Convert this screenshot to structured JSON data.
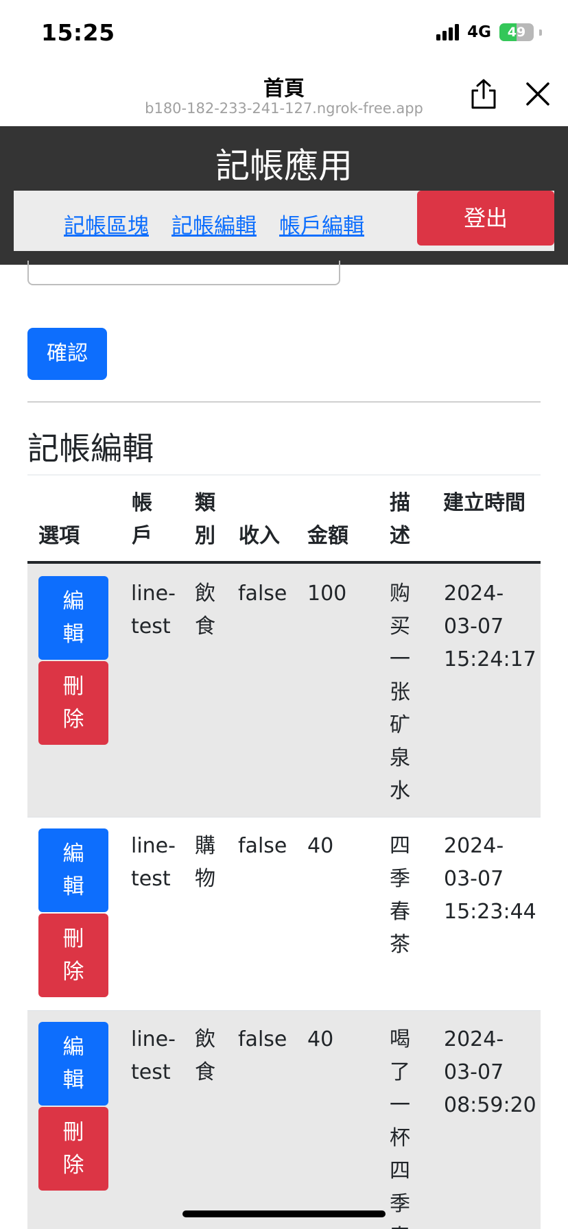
{
  "status_bar": {
    "time": "15:25",
    "network": "4G",
    "battery": "49",
    "battery_level_percent": 49
  },
  "browser": {
    "title": "首頁",
    "url": "b180-182-233-241-127.ngrok-free.app"
  },
  "app": {
    "title": "記帳應用",
    "nav": [
      {
        "label": "記帳區塊"
      },
      {
        "label": "記帳編輯"
      },
      {
        "label": "帳戶編輯"
      }
    ],
    "logout_label": "登出"
  },
  "form": {
    "confirm_label": "確認"
  },
  "section": {
    "title": "記帳編輯"
  },
  "table": {
    "headers": {
      "options": "選項",
      "account": "帳戶",
      "category": "類別",
      "income": "收入",
      "amount": "金額",
      "description": "描述",
      "created_at": "建立時間"
    },
    "edit_label": "編輯",
    "delete_label": "刪除",
    "rows": [
      {
        "account": "line-test",
        "category": "飲食",
        "income": "false",
        "amount": "100",
        "description": "购买一张矿泉水",
        "created_at": "2024-03-07 15:24:17"
      },
      {
        "account": "line-test",
        "category": "購物",
        "income": "false",
        "amount": "40",
        "description": "四季春茶",
        "created_at": "2024-03-07 15:23:44"
      },
      {
        "account": "line-test",
        "category": "飲食",
        "income": "false",
        "amount": "40",
        "description": "喝了一杯四季春",
        "created_at": "2024-03-07 08:59:20"
      }
    ]
  },
  "colors": {
    "primary": "#0d6efd",
    "danger": "#dc3545",
    "header_bg": "#343434",
    "nav_bg": "#ececec",
    "stripe": "#e8e8e8"
  }
}
